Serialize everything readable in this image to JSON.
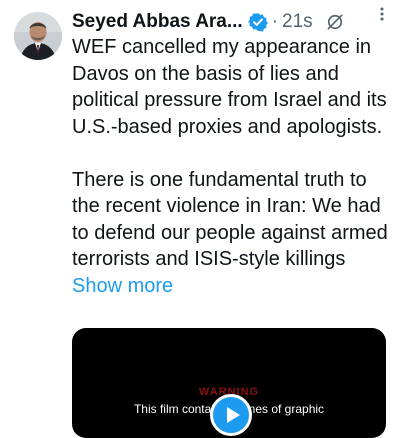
{
  "colors": {
    "accent": "#1d9bf0",
    "text_primary": "#0f1419",
    "text_secondary": "#536471",
    "media_background": "#000000",
    "warning_red": "#8a1010"
  },
  "tweet": {
    "display_name": "Seyed Abbas Ara...",
    "verified_icon": "verified-badge-icon",
    "separator": "·",
    "time": "21s",
    "grok_icon": "grok-icon",
    "more_icon": "more-options-icon",
    "paragraphs": [
      "WEF cancelled my appearance in Davos on the basis of lies and political pressure from Israel and its U.S.-based proxies and apologists.",
      "There is one fundamental truth to the recent violence in Iran: We had to defend our people against armed terrorists and ISIS-style killings"
    ],
    "show_more": "Show more",
    "media": {
      "warning_title": "WARNING",
      "warning_text": "This film contains scenes of graphic",
      "play_icon": "play-icon"
    }
  }
}
